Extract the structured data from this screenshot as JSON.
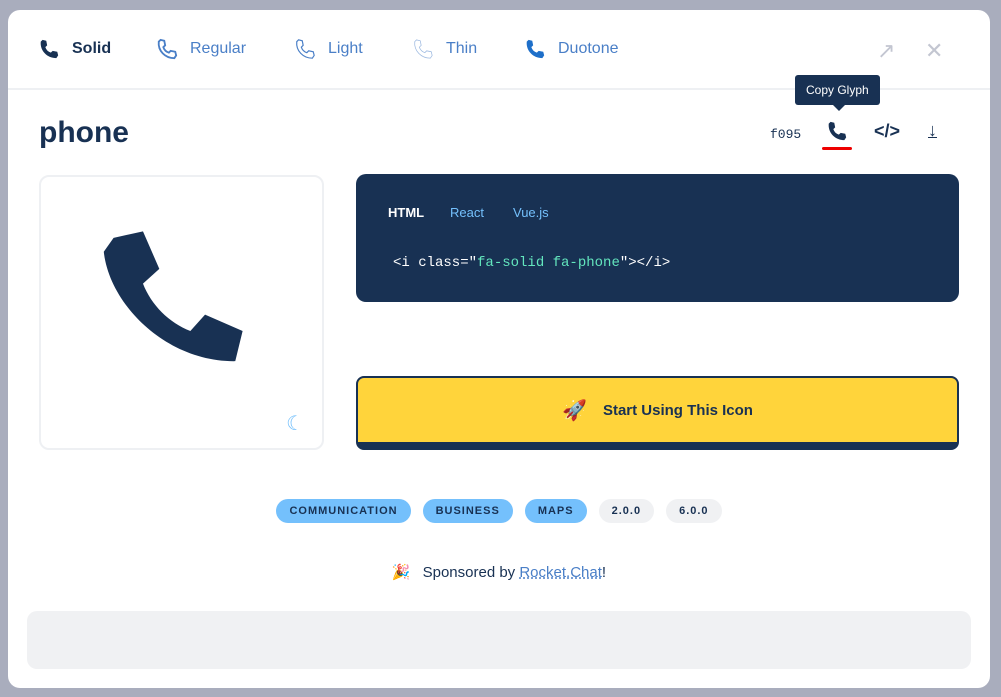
{
  "tabs": [
    {
      "label": "Solid",
      "active": true
    },
    {
      "label": "Regular"
    },
    {
      "label": "Light"
    },
    {
      "label": "Thin"
    },
    {
      "label": "Duotone"
    }
  ],
  "icon": {
    "name": "phone",
    "unicode": "f095"
  },
  "tooltip": "Copy Glyph",
  "code": {
    "tabs": [
      "HTML",
      "React",
      "Vue.js"
    ],
    "pre": "<i class=\"",
    "cls": "fa-solid fa-phone",
    "post": "\"></i>"
  },
  "cta": "Start Using This Icon",
  "tags": [
    "COMMUNICATION",
    "BUSINESS",
    "MAPS"
  ],
  "versions": [
    "2.0.0",
    "6.0.0"
  ],
  "sponsor": {
    "prefix": "Sponsored by ",
    "link": "Rocket.Chat",
    "suffix": "!"
  },
  "colors": {
    "navy": "#183153",
    "yellow": "#ffd43b",
    "blue": "#74c0fc"
  }
}
